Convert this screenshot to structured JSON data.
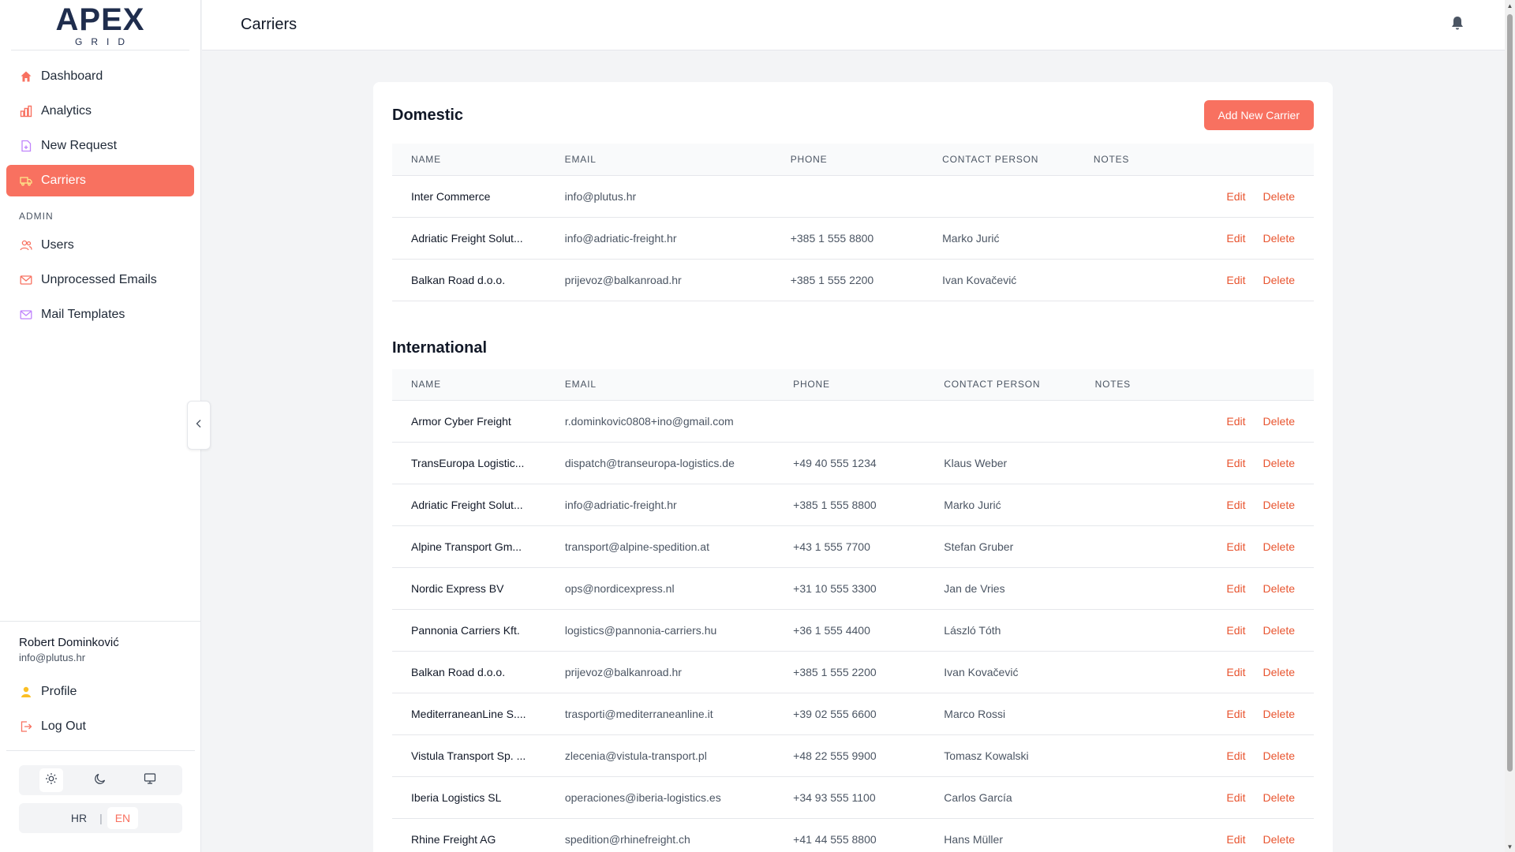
{
  "brand": {
    "logo_main": "APEX",
    "logo_sub": "GRID"
  },
  "header": {
    "title": "Carriers"
  },
  "sidebar": {
    "items": [
      {
        "label": "Dashboard",
        "icon": "home-icon"
      },
      {
        "label": "Analytics",
        "icon": "bar-chart-icon"
      },
      {
        "label": "New Request",
        "icon": "file-plus-icon"
      },
      {
        "label": "Carriers",
        "icon": "truck-icon",
        "active": true
      }
    ],
    "admin_label": "ADMIN",
    "admin_items": [
      {
        "label": "Users",
        "icon": "users-icon"
      },
      {
        "label": "Unprocessed Emails",
        "icon": "mail-icon"
      },
      {
        "label": "Mail Templates",
        "icon": "mail-template-icon"
      }
    ]
  },
  "user": {
    "name": "Robert Dominković",
    "email": "info@plutus.hr"
  },
  "bottom_nav": {
    "profile": "Profile",
    "logout": "Log Out"
  },
  "language": {
    "hr": "HR",
    "en": "EN",
    "active": "EN"
  },
  "theme": {
    "active": "light"
  },
  "colors": {
    "accent": "#f87160",
    "action": "#e8542f"
  },
  "table_headers": {
    "name": "NAME",
    "email": "EMAIL",
    "phone": "PHONE",
    "contact": "CONTACT PERSON",
    "notes": "NOTES"
  },
  "actions": {
    "edit": "Edit",
    "delete": "Delete"
  },
  "add_button": "Add New Carrier",
  "domestic": {
    "title": "Domestic",
    "rows": [
      {
        "name": "Inter Commerce",
        "email": "info@plutus.hr",
        "phone": "",
        "contact": "",
        "notes": ""
      },
      {
        "name": "Adriatic Freight Solut...",
        "email": "info@adriatic-freight.hr",
        "phone": "+385 1 555 8800",
        "contact": "Marko Jurić",
        "notes": ""
      },
      {
        "name": "Balkan Road d.o.o.",
        "email": "prijevoz@balkanroad.hr",
        "phone": "+385 1 555 2200",
        "contact": "Ivan Kovačević",
        "notes": ""
      }
    ]
  },
  "international": {
    "title": "International",
    "rows": [
      {
        "name": "Armor Cyber Freight",
        "email": "r.dominkovic0808+ino@gmail.com",
        "phone": "",
        "contact": "",
        "notes": ""
      },
      {
        "name": "TransEuropa Logistic...",
        "email": "dispatch@transeuropa-logistics.de",
        "phone": "+49 40 555 1234",
        "contact": "Klaus Weber",
        "notes": ""
      },
      {
        "name": "Adriatic Freight Solut...",
        "email": "info@adriatic-freight.hr",
        "phone": "+385 1 555 8800",
        "contact": "Marko Jurić",
        "notes": ""
      },
      {
        "name": "Alpine Transport Gm...",
        "email": "transport@alpine-spedition.at",
        "phone": "+43 1 555 7700",
        "contact": "Stefan Gruber",
        "notes": ""
      },
      {
        "name": "Nordic Express BV",
        "email": "ops@nordicexpress.nl",
        "phone": "+31 10 555 3300",
        "contact": "Jan de Vries",
        "notes": ""
      },
      {
        "name": "Pannonia Carriers Kft.",
        "email": "logistics@pannonia-carriers.hu",
        "phone": "+36 1 555 4400",
        "contact": "László Tóth",
        "notes": ""
      },
      {
        "name": "Balkan Road d.o.o.",
        "email": "prijevoz@balkanroad.hr",
        "phone": "+385 1 555 2200",
        "contact": "Ivan Kovačević",
        "notes": ""
      },
      {
        "name": "MediterraneanLine S....",
        "email": "trasporti@mediterraneanline.it",
        "phone": "+39 02 555 6600",
        "contact": "Marco Rossi",
        "notes": ""
      },
      {
        "name": "Vistula Transport Sp. ...",
        "email": "zlecenia@vistula-transport.pl",
        "phone": "+48 22 555 9900",
        "contact": "Tomasz Kowalski",
        "notes": ""
      },
      {
        "name": "Iberia Logistics SL",
        "email": "operaciones@iberia-logistics.es",
        "phone": "+34 93 555 1100",
        "contact": "Carlos García",
        "notes": ""
      },
      {
        "name": "Rhine Freight AG",
        "email": "spedition@rhinefreight.ch",
        "phone": "+41 44 555 8800",
        "contact": "Hans Müller",
        "notes": ""
      }
    ]
  }
}
